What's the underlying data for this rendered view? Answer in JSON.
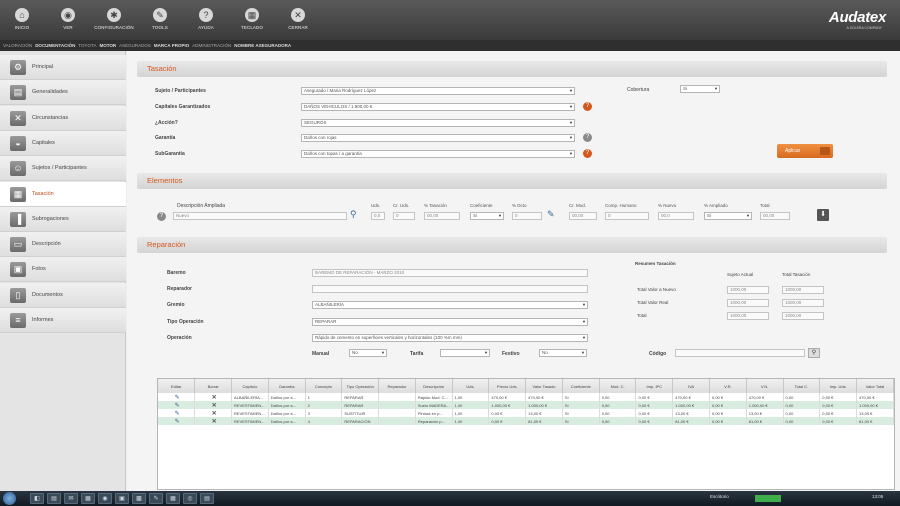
{
  "toolbar": {
    "buttons": [
      {
        "icon": "home-icon",
        "glyph": "⌂",
        "label": "INICIO"
      },
      {
        "icon": "eye-icon",
        "glyph": "◉",
        "label": "VER"
      },
      {
        "icon": "gear-icon",
        "glyph": "✱",
        "label": "CONFIGURACIÓN"
      },
      {
        "icon": "wrench-icon",
        "glyph": "✎",
        "label": "TOOLS"
      },
      {
        "icon": "help-icon",
        "glyph": "?",
        "label": "AYUDA"
      },
      {
        "icon": "keyboard-icon",
        "glyph": "▦",
        "label": "TECLADO"
      },
      {
        "icon": "close-icon",
        "glyph": "✕",
        "label": "CERRAR"
      }
    ],
    "brand": "Audatex",
    "brand_sub": "A SOLERA COMPANY"
  },
  "breadcrumbs": [
    {
      "text": "VALORACIÓN",
      "bold": false
    },
    {
      "text": "DOCUMENTACIÓN",
      "bold": true
    },
    {
      "text": "TOYOTA",
      "bold": false
    },
    {
      "text": "MOTOR",
      "bold": true
    },
    {
      "text": "ASEGURADOS",
      "bold": false
    },
    {
      "text": "MARCA PROPIO",
      "bold": true
    },
    {
      "text": "ADMINISTRACIÓN",
      "bold": false
    },
    {
      "text": "NOMBRE ASEGURADORA",
      "bold": true
    }
  ],
  "sidebar": {
    "items": [
      {
        "label": "Principal",
        "glyph": "⚙"
      },
      {
        "label": "Generalidades",
        "glyph": "▤"
      },
      {
        "label": "Circunstancias",
        "glyph": "✕"
      },
      {
        "label": "Capitales",
        "glyph": "◒"
      },
      {
        "label": "Sujetos / Participantes",
        "glyph": "☺"
      },
      {
        "label": "Tasación",
        "glyph": "▦"
      },
      {
        "label": "Subrogaciones",
        "glyph": "▐"
      },
      {
        "label": "Descripción",
        "glyph": "▭"
      },
      {
        "label": "Fotos",
        "glyph": "▣"
      },
      {
        "label": "Documentos",
        "glyph": "▯"
      },
      {
        "label": "Informes",
        "glyph": "≡"
      }
    ],
    "active": "Tasación"
  },
  "tasacion": {
    "title": "Tasación",
    "fields": [
      {
        "label": "Sujeto / Participantes",
        "value": "Asegurado / Maria Rodríguez López"
      },
      {
        "label": "Capitales Garantizados",
        "value": "DAÑOS VEHICULOS / 1.900,00 €"
      },
      {
        "label": "¿Acción?",
        "value": "SEGUROS"
      },
      {
        "label": "Garantía",
        "value": "Daños con rojas"
      },
      {
        "label": "SubGarantía",
        "value": "Daños con topas / a garantía"
      }
    ],
    "cobertura_label": "Cobertura",
    "cobertura_value": "Si",
    "action_button": "Aplicar"
  },
  "elementos": {
    "title": "Elementos",
    "desc_label": "Descripción Ampliada",
    "desc_value": "Nuevo",
    "columns": [
      {
        "label": "Uds.",
        "value": "0,0"
      },
      {
        "label": "Cr. Uds.",
        "value": "0"
      },
      {
        "label": "% Tasación",
        "value": "00,00"
      },
      {
        "label": "Coeficiente",
        "value": "Si"
      },
      {
        "label": "% Dcto",
        "value": "0"
      },
      {
        "label": "Cr. Mod.",
        "value": "00,00"
      },
      {
        "label": "Comp. Humano",
        "value": "0"
      },
      {
        "label": "% Nuevo",
        "value": "00,0"
      },
      {
        "label": "% Ampliado",
        "value": "Si"
      },
      {
        "label": "Total",
        "value": "00,00"
      }
    ]
  },
  "reparacion": {
    "title": "Reparación",
    "fields": [
      {
        "label": "Baremo",
        "value": "BAREMO DE REPARACIÓN - MARZO 2010",
        "kind": "input"
      },
      {
        "label": "Reparador",
        "value": "",
        "kind": "input"
      },
      {
        "label": "Gremio",
        "value": "ALBAÑILERÍA",
        "kind": "select"
      },
      {
        "label": "Tipo Operación",
        "value": "REPARAR",
        "kind": "select"
      },
      {
        "label": "Operación",
        "value": "Rápido de cemento en superficies verticales y horizontales (100 %m mm)",
        "kind": "select"
      }
    ],
    "manual_label": "Manual",
    "manual_value": "No",
    "tarifa_label": "Tarifa",
    "tarifa_value": "",
    "festivo_label": "Festivo",
    "festivo_value": "No",
    "codigo_label": "Código",
    "codigo_value": "",
    "resumen": {
      "title": "Resumen Tasación",
      "col1": "Sujeto Actual",
      "col2": "Total Tasación",
      "rows": [
        {
          "label": "Total Valor a Nuevo",
          "v1": "1000,00",
          "v2": "1000,00"
        },
        {
          "label": "Total Valor Real",
          "v1": "1000,00",
          "v2": "1000,00"
        },
        {
          "label": "Total",
          "v1": "1000,00",
          "v2": "1000,00"
        }
      ]
    }
  },
  "grid": {
    "headers": [
      "Editar",
      "Borrar",
      "Capítulo",
      "Garantía",
      "Concepto",
      "Tipo Operación",
      "Reparador",
      "Descripción",
      "Uds.",
      "Precio Uds.",
      "Valor Tasado",
      "Coeficiente",
      "Mod. C.",
      "Imp. IPC",
      "IVA",
      "V.R.",
      "V.N.",
      "Total C.",
      "Imp. Uds.",
      "Valor Total"
    ],
    "rows": [
      {
        "style": "w",
        "cells": [
          "",
          "",
          "ALBAÑILERÍA...",
          "Daños por a...",
          "1",
          "REPARAR",
          "",
          "Rápido Mod. C...",
          "1,00",
          "470,00 €",
          "470,00 €",
          "Si",
          "0,00",
          "0,00 €",
          "470,00 €",
          "0,00 €",
          "470,00 €",
          "0,00",
          "0,00 €",
          "470,00 €"
        ]
      },
      {
        "style": "g",
        "cells": [
          "",
          "",
          "REVESTIMIEN...",
          "Daños por a...",
          "2",
          "REPARAR",
          "",
          "Suelo MADERA...",
          "1,00",
          "1.000,00 €",
          "1.000,00 €",
          "Si",
          "0,00",
          "0,00 €",
          "1.000,00 €",
          "0,00 €",
          "1.000,00 €",
          "0,00",
          "0,00 €",
          "1.000,00 €"
        ]
      },
      {
        "style": "w",
        "cells": [
          "",
          "",
          "REVESTIMIEN...",
          "Daños por a...",
          "3",
          "SUSTITUIR",
          "",
          "Pintura en p...",
          "1,00",
          "0,00 €",
          "13,00 €",
          "Si",
          "0,00",
          "0,00 €",
          "13,00 €",
          "0,00 €",
          "13,00 €",
          "0,00",
          "0,00 €",
          "13,00 €"
        ]
      },
      {
        "style": "g",
        "cells": [
          "",
          "",
          "REVESTIMIEN...",
          "Daños por a...",
          "4",
          "REPARACIÓN",
          "",
          "Reparación p...",
          "1,00",
          "0,00 €",
          "81,00 €",
          "Si",
          "0,00",
          "0,00 €",
          "81,00 €",
          "0,00 €",
          "81,00 €",
          "0,00",
          "0,00 €",
          "81,00 €"
        ]
      }
    ]
  },
  "taskbar": {
    "apps": [
      "◧",
      "▤",
      "✉",
      "▦",
      "◉",
      "▣",
      "▩",
      "✎",
      "▦",
      "◎",
      "▤"
    ],
    "tray_label": "Escritorio",
    "clock": "13:05"
  }
}
